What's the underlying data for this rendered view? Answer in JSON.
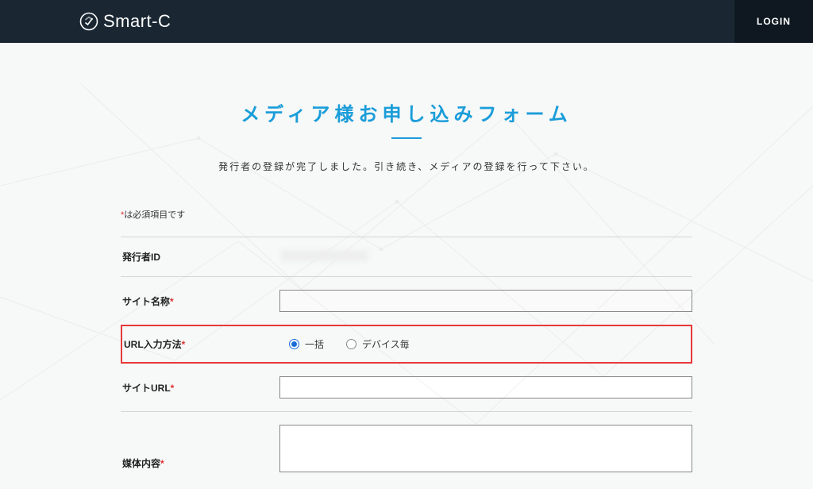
{
  "header": {
    "brand": "Smart-C",
    "login_label": "LOGIN"
  },
  "page": {
    "title": "メディア様お申し込みフォーム",
    "subtitle": "発行者の登録が完了しました。引き続き、メディアの登録を行って下さい。",
    "required_note_prefix": "*",
    "required_note_text": "は必須項目です"
  },
  "form": {
    "publisher_id": {
      "label": "発行者ID",
      "value": ""
    },
    "site_name": {
      "label": "サイト名称",
      "required": "*",
      "value": ""
    },
    "url_input_method": {
      "label": "URL入力方法",
      "required": "*",
      "options": [
        {
          "label": "一括",
          "selected": true
        },
        {
          "label": "デバイス毎",
          "selected": false
        }
      ]
    },
    "site_url": {
      "label": "サイトURL",
      "required": "*",
      "value": ""
    },
    "media_content": {
      "label": "媒体内容",
      "required": "*",
      "value": ""
    }
  }
}
